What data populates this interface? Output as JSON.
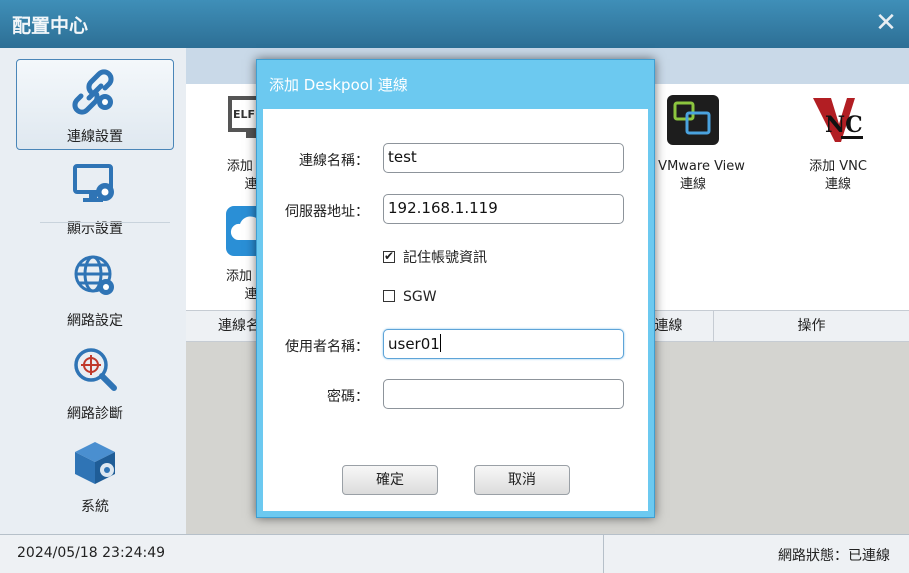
{
  "window": {
    "title": "配置中心"
  },
  "sidebar": {
    "items": [
      {
        "label": "連線設置",
        "icon": "link-icon",
        "active": true
      },
      {
        "label": "顯示設置",
        "icon": "monitor-gear-icon",
        "active": false
      },
      {
        "label": "網路設定",
        "icon": "globe-gear-icon",
        "active": false
      },
      {
        "label": "網路診斷",
        "icon": "network-search-icon",
        "active": false
      },
      {
        "label": "系統",
        "icon": "system-box-icon",
        "active": false
      }
    ]
  },
  "connections": {
    "tiles": [
      {
        "line1": "添加 De",
        "line2": "連",
        "icon": "deskpool-icon"
      },
      {
        "line1": "加 VMware View",
        "line2": "連線",
        "icon": "vmware-view-icon"
      },
      {
        "line1": "添加 VNC",
        "line2": "連線",
        "icon": "vnc-icon"
      },
      {
        "line1": "添加 HD",
        "line2": "連",
        "icon": "cloud-icon"
      }
    ],
    "elf_text": "ELF C"
  },
  "table": {
    "columns": [
      "連線名稱",
      "連線",
      "操作"
    ]
  },
  "status": {
    "datetime": "2024/05/18 23:24:49",
    "network": "網路狀態：已連線"
  },
  "dialog": {
    "title": "添加 Deskpool 連線",
    "fields": {
      "name_label": "連線名稱：",
      "name_value": "test",
      "server_label": "伺服器地址：",
      "server_value": "192.168.1.119",
      "remember_label": "記住帳號資訊",
      "remember_checked": true,
      "sgw_label": "SGW",
      "sgw_checked": false,
      "user_label": "使用者名稱：",
      "user_value": "user01",
      "password_label": "密碼：",
      "password_value": ""
    },
    "ok_label": "確定",
    "cancel_label": "取消"
  },
  "colors": {
    "titlebar": "#2d6f95",
    "dialog_border": "#6cc9f0",
    "focus_border": "#5ea4d8"
  }
}
